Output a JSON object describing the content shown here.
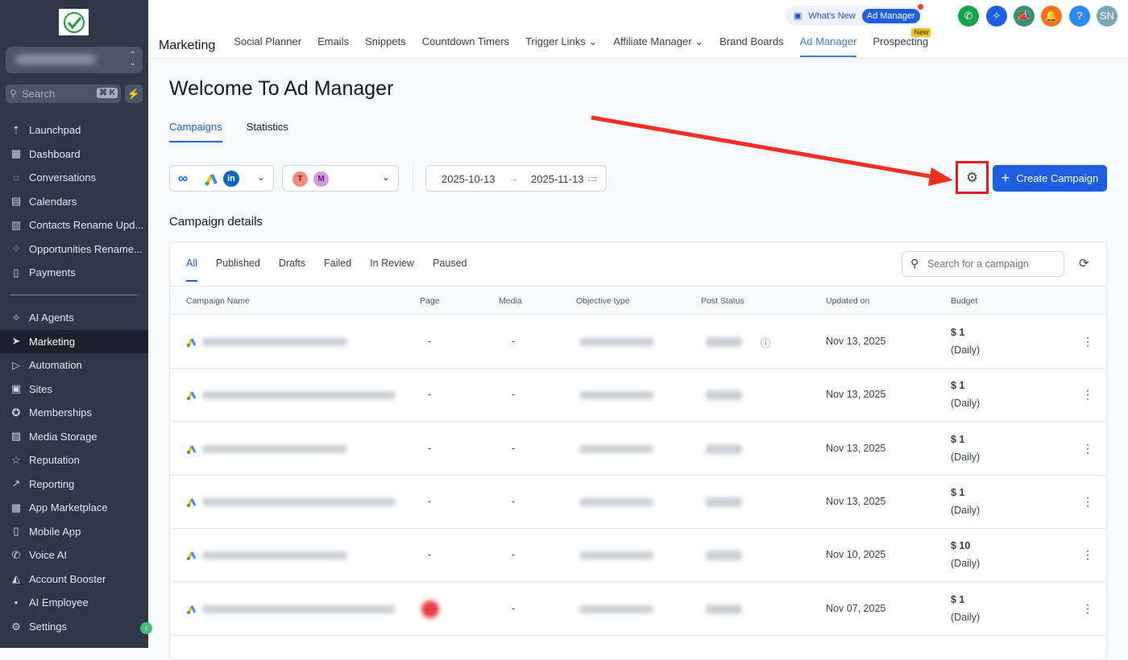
{
  "sidebar": {
    "search_placeholder": "Search",
    "search_shortcut": "⌘ K",
    "items": [
      {
        "label": "Launchpad",
        "icon": "rocket-icon"
      },
      {
        "label": "Dashboard",
        "icon": "grid-icon"
      },
      {
        "label": "Conversations",
        "icon": "chat-icon"
      },
      {
        "label": "Calendars",
        "icon": "calendar-icon"
      },
      {
        "label": "Contacts Rename Upd...",
        "icon": "contacts-icon"
      },
      {
        "label": "Opportunities Rename...",
        "icon": "pipeline-icon"
      },
      {
        "label": "Payments",
        "icon": "payments-icon"
      }
    ],
    "items2": [
      {
        "label": "AI Agents",
        "icon": "sparkle-icon"
      },
      {
        "label": "Marketing",
        "icon": "send-icon",
        "active": true
      },
      {
        "label": "Automation",
        "icon": "automation-icon"
      },
      {
        "label": "Sites",
        "icon": "sites-icon"
      },
      {
        "label": "Memberships",
        "icon": "membership-icon"
      },
      {
        "label": "Media Storage",
        "icon": "image-icon"
      },
      {
        "label": "Reputation",
        "icon": "star-icon"
      },
      {
        "label": "Reporting",
        "icon": "chart-icon"
      },
      {
        "label": "App Marketplace",
        "icon": "apps-icon"
      },
      {
        "label": "Mobile App",
        "icon": "mobile-icon"
      },
      {
        "label": "Voice AI",
        "icon": "phone-icon"
      },
      {
        "label": "Account Booster",
        "icon": "booster-icon"
      },
      {
        "label": "AI Employee",
        "icon": "dot-icon"
      }
    ],
    "settings": "Settings"
  },
  "topbar": {
    "whats_new": "What's New",
    "whats_new_pill": "Ad Manager",
    "avatar": "SN",
    "section": "Marketing",
    "tabs": [
      "Social Planner",
      "Emails",
      "Snippets",
      "Countdown Timers",
      "Trigger Links",
      "Affiliate Manager",
      "Brand Boards",
      "Ad Manager",
      "Prospecting"
    ],
    "active_tab": "Ad Manager",
    "new_badge": "New"
  },
  "page": {
    "title": "Welcome To Ad Manager",
    "subtabs": [
      "Campaigns",
      "Statistics"
    ],
    "accounts": [
      "T",
      "M"
    ],
    "date_from": "2025-10-13",
    "date_to": "2025-11-13",
    "create_label": "Create Campaign",
    "section_title": "Campaign details",
    "filters": [
      "All",
      "Published",
      "Drafts",
      "Failed",
      "In Review",
      "Paused"
    ],
    "search_placeholder": "Search for a campaign",
    "columns": [
      "Campaign Name",
      "Page",
      "Media",
      "Objective type",
      "Post Status",
      "Updated on",
      "Budget"
    ],
    "rows": [
      {
        "page": "-",
        "media": "-",
        "updated": "Nov 13, 2025",
        "budget": "$ 1",
        "period": "(Daily)"
      },
      {
        "page": "-",
        "media": "-",
        "updated": "Nov 13, 2025",
        "budget": "$ 1",
        "period": "(Daily)"
      },
      {
        "page": "-",
        "media": "-",
        "updated": "Nov 13, 2025",
        "budget": "$ 1",
        "period": "(Daily)"
      },
      {
        "page": "-",
        "media": "-",
        "updated": "Nov 13, 2025",
        "budget": "$ 1",
        "period": "(Daily)"
      },
      {
        "page": "-",
        "media": "-",
        "updated": "Nov 10, 2025",
        "budget": "$ 10",
        "period": "(Daily)"
      },
      {
        "page": "",
        "media": "-",
        "updated": "Nov 07, 2025",
        "budget": "$ 1",
        "period": "(Daily)"
      }
    ]
  }
}
